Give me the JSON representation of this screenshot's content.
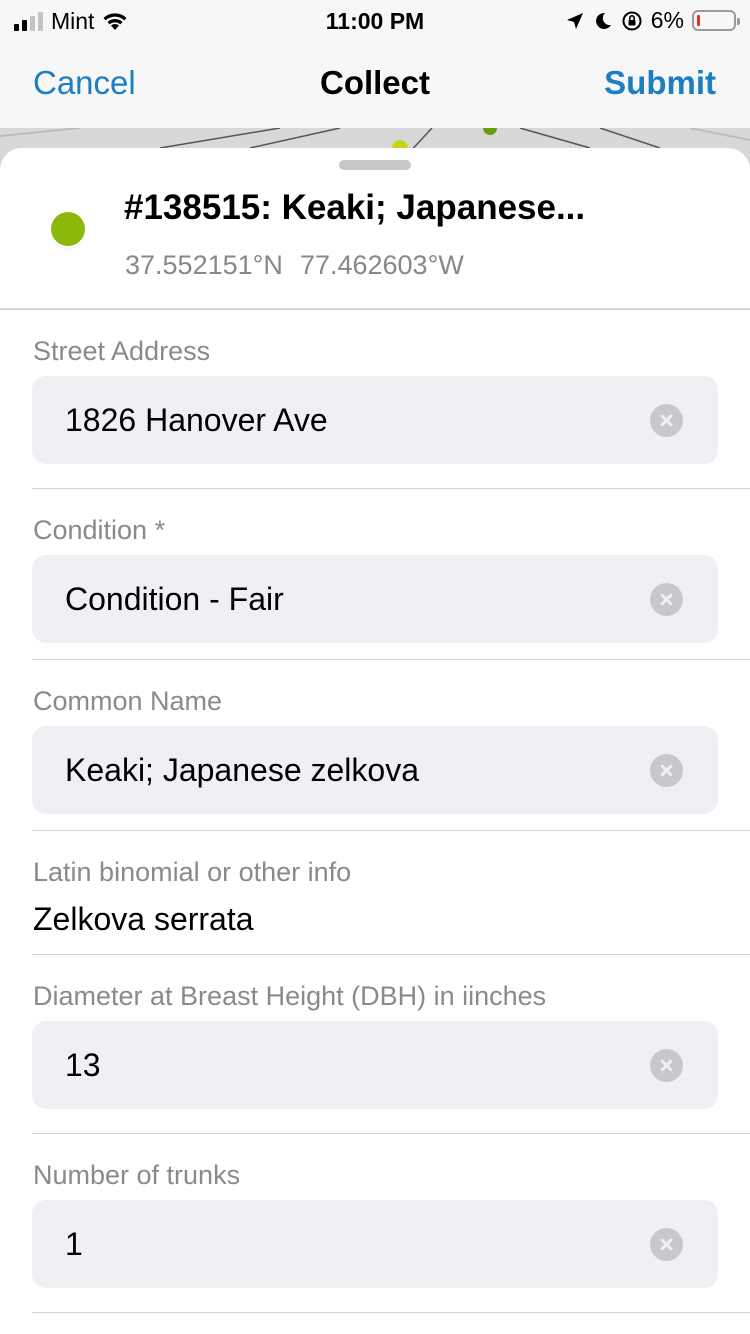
{
  "status_bar": {
    "carrier": "Mint",
    "time": "11:00 PM",
    "battery_percent": "6%"
  },
  "nav": {
    "cancel_label": "Cancel",
    "title": "Collect",
    "submit_label": "Submit"
  },
  "feature": {
    "title": "#138515: Keaki; Japanese...",
    "latitude": "37.552151°N",
    "longitude": "77.462603°W",
    "marker_color": "#8cb80c"
  },
  "form": {
    "street_address": {
      "label": "Street Address",
      "value": "1826 Hanover Ave"
    },
    "condition": {
      "label": "Condition *",
      "value": "Condition - Fair"
    },
    "common_name": {
      "label": "Common Name",
      "value": "Keaki; Japanese zelkova"
    },
    "latin": {
      "label": "Latin binomial or other info",
      "value": "Zelkova serrata"
    },
    "dbh": {
      "label": "Diameter at Breast Height (DBH) in iinches",
      "value": "13"
    },
    "trunks": {
      "label": "Number of trunks",
      "value": "1"
    }
  },
  "colors": {
    "accent": "#1b7fc2",
    "field_bg": "#f0f0f4",
    "label_gray": "#8a8a8e"
  }
}
